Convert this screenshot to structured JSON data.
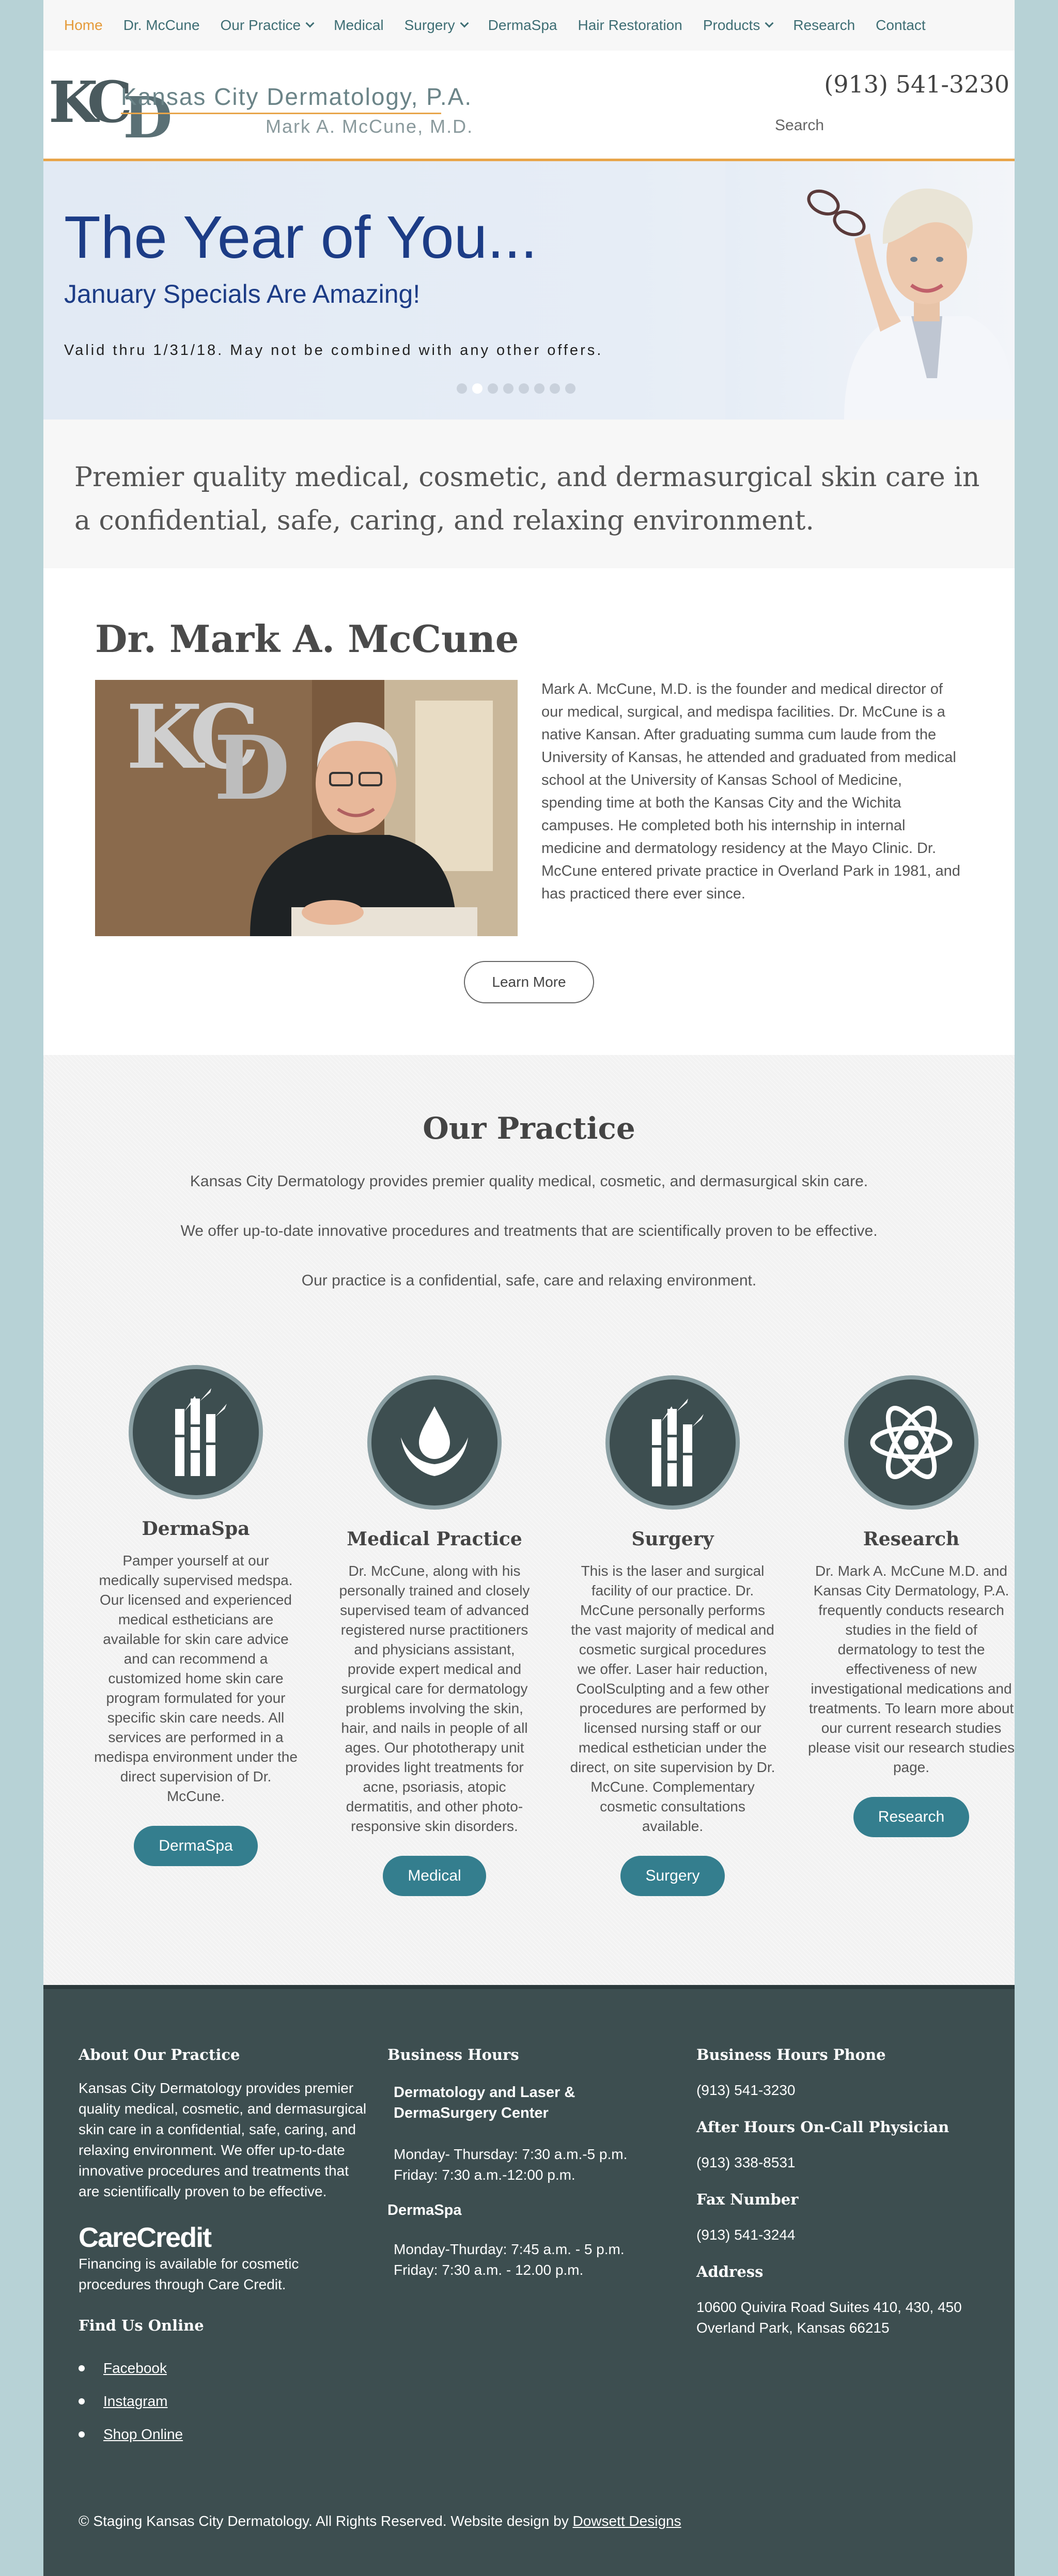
{
  "nav": {
    "items": [
      {
        "label": "Home",
        "active": true,
        "dropdown": false
      },
      {
        "label": "Dr. McCune",
        "dropdown": false
      },
      {
        "label": "Our Practice",
        "dropdown": true
      },
      {
        "label": "Medical",
        "dropdown": false
      },
      {
        "label": "Surgery",
        "dropdown": true
      },
      {
        "label": "DermaSpa",
        "dropdown": false
      },
      {
        "label": "Hair Restoration",
        "dropdown": false
      },
      {
        "label": "Products",
        "dropdown": true
      },
      {
        "label": "Research",
        "dropdown": false
      },
      {
        "label": "Contact",
        "dropdown": false
      }
    ]
  },
  "header": {
    "logo_mark": "KCD",
    "logo_name": "Kansas City Dermatology, P.A.",
    "logo_doctor": "Mark A. McCune, M.D.",
    "phone": "(913) 541-3230",
    "search_label": "Search"
  },
  "hero": {
    "title": "The Year of You...",
    "subtitle": "January Specials Are Amazing!",
    "valid": "Valid thru 1/31/18. May not be combined with any other offers.",
    "slides": 8,
    "active_slide": 1
  },
  "tagline": "Premier quality medical, cosmetic, and dermasurgical skin care in a confidential, safe, caring, and relaxing environment.",
  "doctor": {
    "title": "Dr. Mark A. McCune",
    "bio": "Mark A. McCune, M.D. is the founder and medical director of our medical, surgical, and medispa facilities. Dr. McCune is a native Kansan. After graduating summa cum laude from the University of Kansas, he attended and graduated from medical school at the University of Kansas School of Medicine, spending time at both the Kansas City and the Wichita campuses. He completed both his internship in internal medicine and dermatology residency at the Mayo Clinic. Dr. McCune entered private practice in Overland Park in 1981, and has practiced there ever since.",
    "learn_more": "Learn More"
  },
  "practice": {
    "title": "Our Practice",
    "lines": [
      "Kansas City Dermatology provides premier quality medical, cosmetic, and dermasurgical skin care.",
      "We offer up-to-date innovative procedures and treatments that are scientifically proven to be effective.",
      "Our practice is a confidential, safe, care and relaxing environment."
    ],
    "columns": [
      {
        "icon": "bamboo-icon",
        "heading": "DermaSpa",
        "text": "Pamper yourself at our medically supervised medspa. Our licensed and experienced medical estheticians are available for skin care advice and can recommend a customized home skin care program formulated for your specific skin care needs. All services are performed in a medispa environment under the direct supervision of Dr. McCune.",
        "button": "DermaSpa"
      },
      {
        "icon": "drop-in-hands-icon",
        "heading": "Medical Practice",
        "text": "Dr. McCune, along with his personally trained and closely supervised team of advanced registered nurse practitioners and physicians assistant, provide expert medical and surgical care for dermatology problems involving the skin, hair, and nails in people of all ages. Our phototherapy unit provides light treatments for acne, psoriasis, atopic dermatitis, and other photo-responsive skin disorders.",
        "button": "Medical"
      },
      {
        "icon": "bamboo-icon",
        "heading": "Surgery",
        "text": "This is the laser and surgical facility of our practice. Dr. McCune personally performs the vast majority of medical and cosmetic surgical procedures we offer. Laser hair reduction, CoolSculpting and a few other procedures are performed by licensed nursing staff or our medical esthetician under the direct, on site supervision by Dr. McCune. Complementary cosmetic consultations available.",
        "button": "Surgery"
      },
      {
        "icon": "atom-icon",
        "heading": "Research",
        "text": "Dr. Mark A. McCune M.D. and Kansas City Dermatology, P.A. frequently conducts research studies in the field of dermatology to test the effectiveness of new investigational medications and treatments. To learn more about our current research studies please visit our research studies page.",
        "button": "Research"
      }
    ]
  },
  "footer": {
    "about": {
      "heading": "About Our Practice",
      "text": "Kansas City Dermatology provides premier quality medical, cosmetic, and dermasurgical skin care in a confidential, safe, caring, and relaxing environment. We offer up-to-date innovative procedures and treatments that are scientifically proven to be effective.",
      "carecredit_logo": "CareCredit",
      "financing": "Financing is available for cosmetic procedures through Care Credit.",
      "find_us": "Find Us Online",
      "links": [
        "Facebook",
        "Instagram",
        "Shop Online"
      ]
    },
    "hours": {
      "heading": "Business Hours",
      "center_name": "Dermatology and Laser & DermaSurgery Center",
      "center_hours_1": "Monday- Thursday: 7:30 a.m.-5 p.m.",
      "center_hours_2": "Friday: 7:30 a.m.-12:00 p.m.",
      "spa_name": "DermaSpa",
      "spa_hours_1": "Monday-Thurday: 7:45 a.m. - 5 p.m.",
      "spa_hours_2": "Friday: 7:30 a.m. - 12.00 p.m."
    },
    "contact": {
      "phone_heading": "Business Hours Phone",
      "phone": "(913) 541-3230",
      "oncall_heading": "After Hours On-Call Physician",
      "oncall": "(913) 338-8531",
      "fax_heading": "Fax Number",
      "fax": "(913) 541-3244",
      "address_heading": "Address",
      "address_1": "10600 Quivira Road Suites 410, 430, 450",
      "address_2": "Overland Park, Kansas 66215"
    },
    "copyright": "© Staging Kansas City Dermatology. All Rights Reserved. Website design by",
    "designer": "Dowsett Designs"
  },
  "colors": {
    "accent": "#e8a54a",
    "teal": "#347e8e",
    "dark": "#3d4e50",
    "hero_blue": "#1c3c86"
  }
}
